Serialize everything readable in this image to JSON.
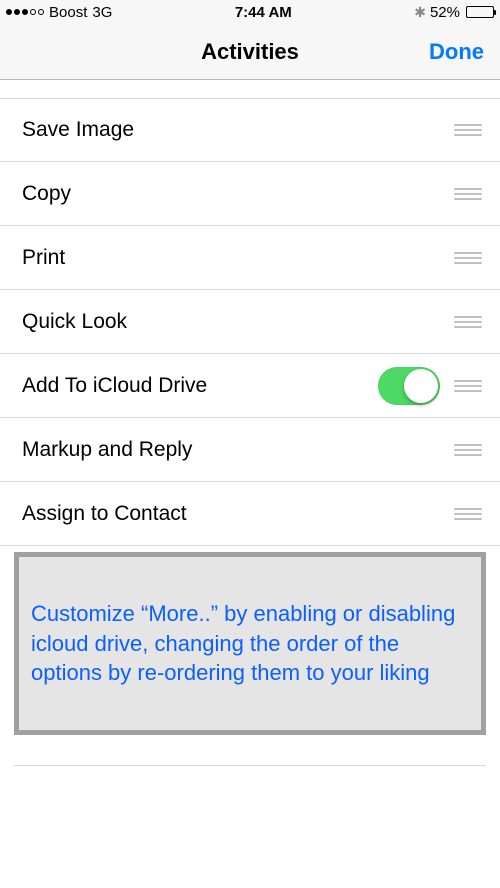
{
  "status": {
    "carrier": "Boost",
    "network": "3G",
    "time": "7:44 AM",
    "battery_pct": "52%",
    "battery_fill_pct": 52
  },
  "nav": {
    "title": "Activities",
    "done": "Done"
  },
  "rows": [
    {
      "label": "Save Image",
      "toggle": false
    },
    {
      "label": "Copy",
      "toggle": false
    },
    {
      "label": "Print",
      "toggle": false
    },
    {
      "label": "Quick Look",
      "toggle": false
    },
    {
      "label": "Add To iCloud Drive",
      "toggle": true
    },
    {
      "label": "Markup and Reply",
      "toggle": false
    },
    {
      "label": "Assign to Contact",
      "toggle": false
    }
  ],
  "tip": "Customize “More..” by enabling or disabling icloud drive, changing the order of the options by re-ordering them to your liking"
}
